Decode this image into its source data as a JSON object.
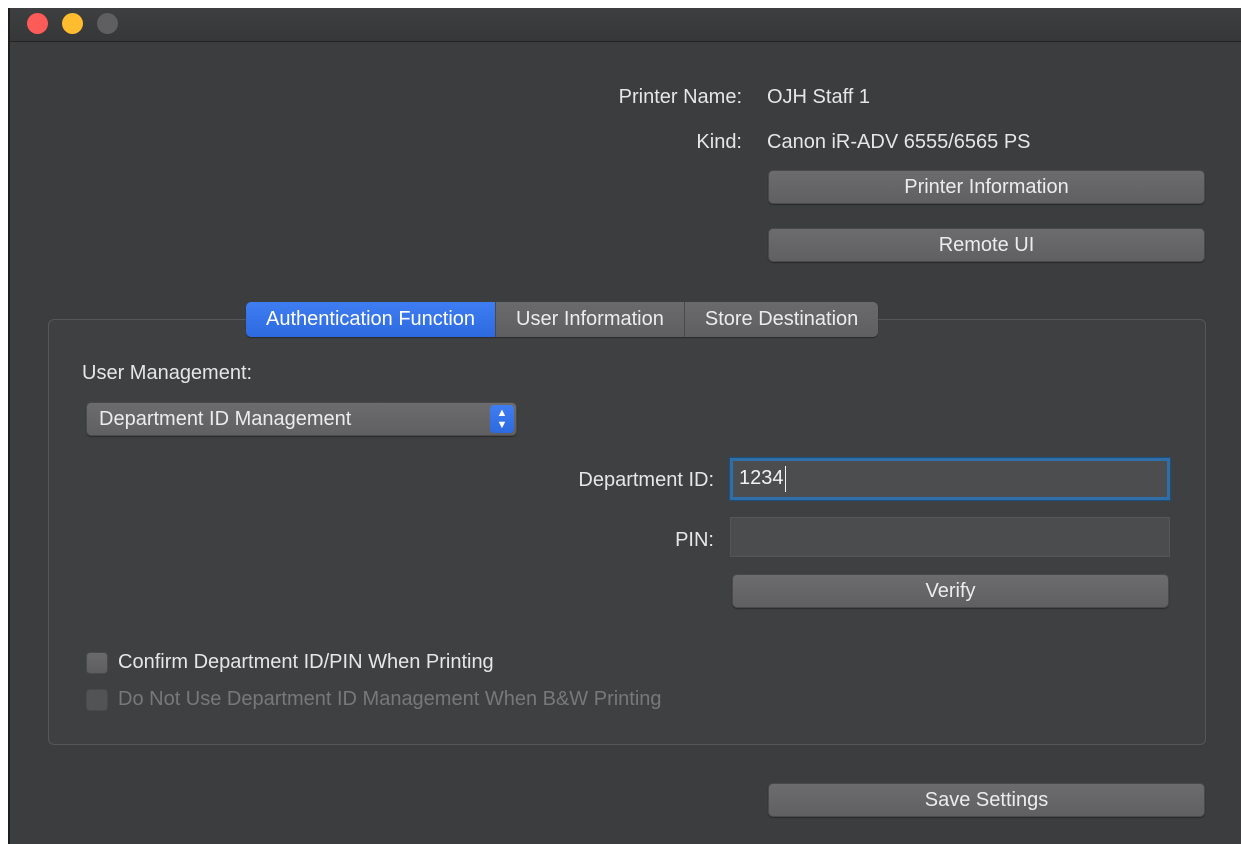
{
  "window": {
    "traffic_lights": [
      "close",
      "minimize",
      "zoom"
    ]
  },
  "printer": {
    "name_label": "Printer Name:",
    "name_value": "OJH Staff 1",
    "kind_label": "Kind:",
    "kind_value": "Canon iR-ADV 6555/6565 PS",
    "info_button": "Printer Information",
    "remote_button": "Remote UI"
  },
  "tabs": [
    {
      "label": "Authentication Function",
      "active": true
    },
    {
      "label": "User Information",
      "active": false
    },
    {
      "label": "Store Destination",
      "active": false
    }
  ],
  "auth": {
    "user_management_label": "User Management:",
    "user_management_value": "Department ID Management",
    "department_id_label": "Department ID:",
    "department_id_value": "1234",
    "pin_label": "PIN:",
    "pin_value": "",
    "verify_button": "Verify",
    "confirm_checkbox_label": "Confirm Department ID/PIN When Printing",
    "confirm_checked": false,
    "bw_checkbox_label": "Do Not Use Department ID Management When B&W Printing",
    "bw_checked": false,
    "bw_enabled": false
  },
  "footer": {
    "save_button": "Save Settings"
  },
  "colors": {
    "window_bg": "#3c3d3e",
    "accent": "#2d6ae0",
    "focus_ring": "#2f6ea8"
  }
}
